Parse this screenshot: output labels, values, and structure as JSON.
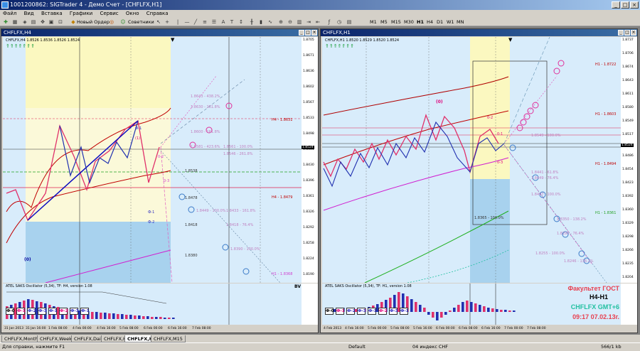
{
  "window": {
    "title": "1001200862: SIGTrader 4 - Демо Счет - [CHFLFX,H1]"
  },
  "menu": [
    "Файл",
    "Вид",
    "Вставка",
    "Графики",
    "Сервис",
    "Окно",
    "Справка"
  ],
  "toolbar": {
    "new_order": "Новый Ордер",
    "experts": "Советники",
    "timeframes": [
      "M1",
      "M5",
      "M15",
      "M30",
      "H1",
      "H4",
      "D1",
      "W1",
      "MN"
    ]
  },
  "left_chart": {
    "title": "CHFLFX,H4",
    "info": "CHFLFX,H4  1.8526 1.8536 1.8526 1.8524",
    "osc_label": "ATEL SAKS Oscillator (5,34), TF: H4, version 1.08",
    "osc_right": "BV",
    "wave_labels": [
      "Ф-0",
      "Ф-1",
      "Ф-2",
      "Ф-3",
      "Ф-1",
      "Ф-2",
      "Ф-3",
      "Ф-1"
    ],
    "wave_colors": [
      "#000",
      "#e0007a",
      "#2a2ac0",
      "#2a2ac0",
      "#2a2ac0",
      "#e0007a",
      "#2a2ac0",
      "#2a2ac0"
    ],
    "price_scale": [
      "1.8705",
      "1.8671",
      "1.8636",
      "1.8602",
      "1.8567",
      "1.8533",
      "1.8498",
      "1.8464",
      "1.8430",
      "1.8396",
      "1.8361",
      "1.8326",
      "1.8292",
      "1.8258",
      "1.8224",
      "1.8190"
    ],
    "current_price": "1.8524",
    "x_labels": [
      "31 Jan 2013",
      "31 Jan 16:00",
      "1 Feb 08:00",
      "4 Feb 00:00",
      "4 Feb 16:00",
      "5 Feb 08:00",
      "6 Feb 00:00",
      "6 Feb 16:00",
      "7 Feb 08:00"
    ],
    "levels": [
      {
        "text": "H4 - 1.8631",
        "color": "#c00000"
      },
      {
        "text": "H4 - 1.8479",
        "color": "#c00000"
      },
      {
        "text": "H1 - 1.8368",
        "color": "#d040d0"
      },
      {
        "text": "1.8643 - 438.2%",
        "color": "#c080c0"
      },
      {
        "text": "1.8630 - 261.8%",
        "color": "#c080c0"
      },
      {
        "text": "1.8600 - 161.8%",
        "color": "#c080c0"
      },
      {
        "text": "1.8581 - 423.6%",
        "color": "#c080c0"
      },
      {
        "text": "1.8561 - 100.0%",
        "color": "#c080c0"
      },
      {
        "text": "1.8546 - 261.8%",
        "color": "#c080c0"
      },
      {
        "text": "1.8538",
        "color": "#333"
      },
      {
        "text": "1.8478",
        "color": "#333"
      },
      {
        "text": "1.8449 - 100.0%",
        "color": "#c080c0"
      },
      {
        "text": "1.8433 - 161.8%",
        "color": "#c080c0"
      },
      {
        "text": "1.8418 - 76.4%",
        "color": "#c080c0"
      },
      {
        "text": "1.8418",
        "color": "#333"
      },
      {
        "text": "1.8390 - 100.0%",
        "color": "#c080c0"
      },
      {
        "text": "1.8380",
        "color": "#333"
      }
    ],
    "waves": [
      {
        "text": "(0)",
        "color": "#0a0aa0"
      },
      {
        "text": "Ф-1",
        "color": "#2a2ac0"
      },
      {
        "text": "(1)",
        "color": "#e0007a"
      },
      {
        "text": "0-2",
        "color": "#d040d0"
      },
      {
        "text": "0-3",
        "color": "#d040d0"
      },
      {
        "text": "Ф-1",
        "color": "#2a2ac0"
      },
      {
        "text": "Ф-2",
        "color": "#2a2ac0"
      }
    ]
  },
  "right_chart": {
    "title": "CHFLFX,H1",
    "info": "CHFLFX,H1  1.8520 1.8529 1.8520 1.8524",
    "osc_label": "ATEL SAKS Oscillator (5,34), TF: H1, version 1.08",
    "wave_labels": [
      "Ф-0",
      "Ф-1",
      "Ф-2",
      "Ф-3",
      "Ф-1",
      "Ф-2",
      "Ф-3",
      "Ф-1"
    ],
    "wave_colors": [
      "#000",
      "#e0007a",
      "#2a2ac0",
      "#2a2ac0",
      "#2a2ac0",
      "#e0007a",
      "#2a2ac0",
      "#2a2ac0"
    ],
    "price_scale": [
      "1.8737",
      "1.8706",
      "1.8674",
      "1.8643",
      "1.8611",
      "1.8580",
      "1.8549",
      "1.8517",
      "1.8486",
      "1.8454",
      "1.8423",
      "1.8392",
      "1.8360",
      "1.8329",
      "1.8298",
      "1.8266",
      "1.8235",
      "1.8204"
    ],
    "current_price": "1.8524",
    "x_labels": [
      "4 Feb 2013",
      "4 Feb 16:00",
      "5 Feb 00:00",
      "5 Feb 08:00",
      "5 Feb 16:00",
      "6 Feb 00:00",
      "6 Feb 08:00",
      "6 Feb 16:00",
      "7 Feb 00:00",
      "7 Feb 08:00"
    ],
    "levels": [
      {
        "text": "H1 - 1.8722",
        "color": "#c00000"
      },
      {
        "text": "H1 - 1.8603",
        "color": "#c00000"
      },
      {
        "text": "H1 - 1.8494",
        "color": "#c00000"
      },
      {
        "text": "H1 - 1.8361",
        "color": "#20a020"
      },
      {
        "text": "1.8549 - 100.0%",
        "color": "#c080c0"
      },
      {
        "text": "1.8449 - 76.4%",
        "color": "#c080c0"
      },
      {
        "text": "1.8441 - 61.8%",
        "color": "#c080c0"
      },
      {
        "text": "1.8407 - 100.0%",
        "color": "#c080c0"
      },
      {
        "text": "1.8350 - 138.2%",
        "color": "#c080c0"
      },
      {
        "text": "1.8290 - 76.4%",
        "color": "#c080c0"
      },
      {
        "text": "1.8246 - 138.2%",
        "color": "#c080c0"
      },
      {
        "text": "1.8255 - 100.0%",
        "color": "#c080c0"
      },
      {
        "text": "1.8365 - 100.0%",
        "color": "#333"
      }
    ],
    "waves": [
      {
        "text": "(0)",
        "color": "#e0007a"
      },
      {
        "text": "0-2",
        "color": "#e0007a"
      },
      {
        "text": "0-1",
        "color": "#e0007a"
      },
      {
        "text": "0-3",
        "color": "#e0007a"
      }
    ]
  },
  "stamp": {
    "line1": "Факультет ГОСТ",
    "line2": "H4-H1",
    "line3": "CHFLFX   GMT+6",
    "line4": "09:17  07.02.13г.",
    "c1": "#e84050",
    "c2": "#000000",
    "c3": "#20c0a0",
    "c4": "#e84050"
  },
  "tabs": [
    "CHFLFX,Monthly",
    "CHFLFX,Weekly",
    "CHFLFX,Daily",
    "CHFLFX,H4",
    "CHFLFX,H1",
    "CHFLFX,M15"
  ],
  "active_tab": 4,
  "status": {
    "help": "Для справки, нажмите F1",
    "profile": "Default",
    "connection": "04 индекс CHF",
    "traffic": "566/1 kb"
  }
}
